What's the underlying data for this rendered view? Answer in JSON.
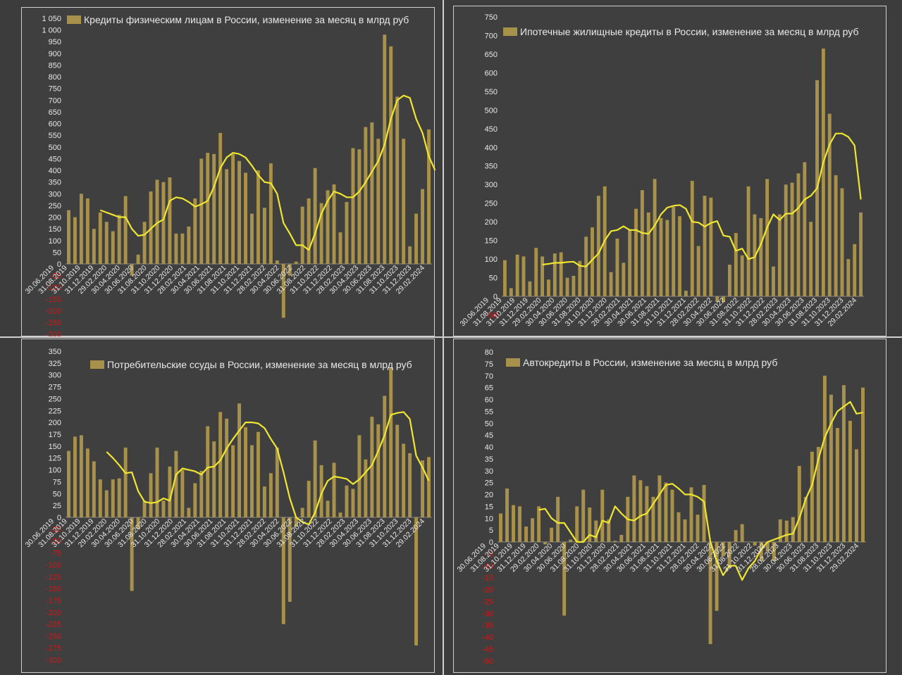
{
  "colors": {
    "bar": "#a8914a",
    "ma": "#f0e630",
    "text": "#e8e8e8",
    "neg_text": "#e01010",
    "background": "#404040"
  },
  "chart_data": [
    {
      "type": "bar",
      "legend": "Кредиты физическим лицам  в России, изменение за месяц в млрд руб",
      "ylim": [
        -300,
        1050
      ],
      "ystep": 50,
      "ytick_labels": [
        "-300",
        "-250",
        "-200",
        "-150",
        "-100",
        "-50",
        "0",
        "50",
        "100",
        "150",
        "200",
        "250",
        "300",
        "350",
        "400",
        "450",
        "500",
        "550",
        "600",
        "650",
        "700",
        "750",
        "800",
        "850",
        "900",
        "950",
        "1 000",
        "1 050"
      ],
      "xtick_labels": [
        "30.06.2019",
        "31.08.2019",
        "31.10.2019",
        "31.12.2019",
        "29.02.2020",
        "30.04.2020",
        "30.06.2020",
        "31.08.2020",
        "31.10.2020",
        "31.12.2020",
        "28.02.2021",
        "30.04.2021",
        "30.06.2021",
        "31.08.2021",
        "31.10.2021",
        "31.12.2021",
        "28.02.2022",
        "30.04.2022",
        "30.06.2022",
        "31.08.2022",
        "31.10.2022",
        "31.12.2022",
        "28.02.2023",
        "30.04.2023",
        "30.06.2023",
        "31.08.2023",
        "31.10.2023",
        "31.12.2023",
        "29.02.2024"
      ],
      "values": [
        230,
        200,
        300,
        280,
        150,
        220,
        180,
        140,
        210,
        290,
        -50,
        40,
        180,
        310,
        360,
        350,
        370,
        130,
        130,
        160,
        280,
        450,
        475,
        470,
        560,
        405,
        470,
        440,
        390,
        215,
        400,
        240,
        430,
        15,
        -230,
        -50,
        10,
        245,
        280,
        410,
        260,
        315,
        340,
        135,
        265,
        495,
        490,
        585,
        605,
        535,
        980,
        930,
        715,
        535,
        75,
        215,
        320,
        575
      ],
      "ma": [
        null,
        null,
        null,
        null,
        null,
        230,
        220,
        210,
        200,
        200,
        150,
        120,
        125,
        150,
        175,
        190,
        270,
        285,
        280,
        265,
        245,
        255,
        270,
        330,
        410,
        455,
        475,
        470,
        455,
        420,
        380,
        350,
        345,
        300,
        175,
        130,
        80,
        80,
        60,
        130,
        215,
        270,
        310,
        300,
        285,
        285,
        310,
        350,
        395,
        440,
        510,
        620,
        700,
        720,
        710,
        620,
        560,
        460,
        400
      ]
    },
    {
      "type": "bar",
      "legend": "Ипотечные жилищные кредиты в России, изменение за месяц в млрд руб",
      "ylim": [
        -50,
        750
      ],
      "ystep": 50,
      "ytick_labels": [
        "-50",
        "0",
        "50",
        "100",
        "150",
        "200",
        "250",
        "300",
        "350",
        "400",
        "450",
        "500",
        "550",
        "600",
        "650",
        "700",
        "750"
      ],
      "xtick_labels": [
        "30.06.2019",
        "31.08.2019",
        "31.10.2019",
        "31.12.2019",
        "29.02.2020",
        "30.04.2020",
        "30.06.2020",
        "31.08.2020",
        "31.10.2020",
        "31.12.2020",
        "28.02.2021",
        "30.04.2021",
        "30.06.2021",
        "31.08.2021",
        "31.10.2021",
        "31.12.2021",
        "28.02.2022",
        "30.04.2022",
        "30.06.2022",
        "31.08.2022",
        "31.10.2022",
        "31.12.2022",
        "28.02.2023",
        "30.04.2023",
        "30.06.2023",
        "31.08.2023",
        "31.10.2023",
        "31.12.2023",
        "29.02.2024"
      ],
      "values": [
        97,
        22,
        112,
        107,
        40,
        130,
        107,
        45,
        115,
        118,
        50,
        55,
        95,
        160,
        185,
        270,
        295,
        65,
        155,
        90,
        180,
        235,
        285,
        225,
        315,
        210,
        205,
        240,
        215,
        15,
        310,
        135,
        270,
        265,
        -15,
        -15,
        85,
        170,
        110,
        295,
        220,
        210,
        315,
        80,
        220,
        300,
        305,
        330,
        360,
        200,
        580,
        665,
        490,
        325,
        290,
        100,
        140,
        225
      ],
      "ma": [
        null,
        null,
        null,
        null,
        null,
        null,
        85,
        87,
        90,
        90,
        92,
        93,
        82,
        80,
        98,
        115,
        150,
        175,
        178,
        188,
        178,
        178,
        170,
        168,
        190,
        220,
        238,
        243,
        245,
        235,
        200,
        198,
        187,
        197,
        202,
        163,
        160,
        122,
        128,
        100,
        105,
        140,
        185,
        220,
        205,
        222,
        222,
        237,
        260,
        270,
        290,
        360,
        408,
        437,
        437,
        428,
        405,
        260
      ]
    },
    {
      "type": "bar",
      "legend": "Потребительские ссуды в России, изменение за месяц в млрд руб",
      "ylim": [
        -300,
        350
      ],
      "ystep": 25,
      "ytick_labels": [
        "-300",
        "-275",
        "-250",
        "-225",
        "-200",
        "-175",
        "-150",
        "-125",
        "-100",
        "-75",
        "-50",
        "-25",
        "0",
        "25",
        "50",
        "75",
        "100",
        "125",
        "150",
        "175",
        "200",
        "225",
        "250",
        "275",
        "300",
        "325",
        "350"
      ],
      "xtick_labels": [
        "30.06.2019",
        "31.08.2019",
        "31.10.2019",
        "31.12.2019",
        "29.02.2020",
        "30.04.2020",
        "30.06.2020",
        "31.08.2020",
        "31.10.2020",
        "31.12.2020",
        "28.02.2021",
        "30.04.2021",
        "30.06.2021",
        "31.08.2021",
        "31.10.2021",
        "31.12.2021",
        "28.02.2022",
        "30.04.2022",
        "30.06.2022",
        "31.08.2022",
        "31.10.2022",
        "31.12.2022",
        "28.02.2023",
        "30.04.2023",
        "30.06.2023",
        "31.08.2023",
        "31.10.2023",
        "31.12.2023",
        "29.02.2024"
      ],
      "values": [
        140,
        170,
        173,
        145,
        118,
        80,
        57,
        80,
        82,
        147,
        -155,
        -25,
        35,
        93,
        147,
        35,
        107,
        140,
        100,
        20,
        72,
        98,
        192,
        160,
        222,
        208,
        152,
        240,
        190,
        152,
        180,
        65,
        93,
        147,
        -225,
        -178,
        -20,
        20,
        77,
        162,
        110,
        35,
        115,
        10,
        67,
        60,
        173,
        122,
        212,
        196,
        256,
        316,
        195,
        155,
        135,
        -270,
        120,
        127
      ],
      "ma": [
        null,
        null,
        null,
        null,
        null,
        null,
        138,
        125,
        110,
        93,
        95,
        55,
        33,
        30,
        32,
        40,
        35,
        90,
        103,
        100,
        97,
        90,
        105,
        107,
        120,
        145,
        165,
        183,
        200,
        200,
        198,
        188,
        165,
        145,
        95,
        40,
        0,
        -10,
        -15,
        10,
        50,
        77,
        86,
        84,
        81,
        70,
        80,
        95,
        110,
        140,
        173,
        216,
        220,
        222,
        207,
        130,
        105,
        77
      ]
    },
    {
      "type": "bar",
      "legend": "Автокредиты в России, изменение за месяц в млрд руб",
      "ylim": [
        -50,
        80
      ],
      "ystep": 5,
      "ytick_labels": [
        "-50",
        "-45",
        "-40",
        "-35",
        "-30",
        "-25",
        "-20",
        "-15",
        "-10",
        "-5",
        "0",
        "5",
        "10",
        "15",
        "20",
        "25",
        "30",
        "35",
        "40",
        "45",
        "50",
        "55",
        "60",
        "65",
        "70",
        "75",
        "80"
      ],
      "xtick_labels": [
        "30.06.2019",
        "31.08.2019",
        "31.10.2019",
        "31.12.2019",
        "29.02.2020",
        "30.04.2020",
        "30.06.2020",
        "31.08.2020",
        "31.10.2020",
        "31.12.2020",
        "28.02.2021",
        "30.04.2021",
        "30.06.2021",
        "31.08.2021",
        "31.10.2021",
        "31.12.2021",
        "28.02.2022",
        "30.04.2022",
        "30.06.2022",
        "31.08.2022",
        "31.10.2022",
        "31.12.2022",
        "28.02.2023",
        "30.04.2023",
        "30.06.2023",
        "31.08.2023",
        "31.10.2023",
        "31.12.2023",
        "29.02.2024"
      ],
      "values": [
        12,
        22.5,
        15.5,
        15,
        6.5,
        10,
        15,
        -1,
        6,
        19,
        -31,
        1,
        15,
        22,
        14.5,
        9,
        22,
        9.5,
        0.5,
        3,
        19,
        28,
        26,
        23.5,
        19,
        28,
        25,
        22,
        12.5,
        9.5,
        23,
        11.5,
        24,
        -43,
        -29,
        -6,
        -11,
        5,
        7.5,
        0,
        -1.5,
        -8,
        -4,
        -8,
        9.5,
        9,
        10.5,
        32,
        19,
        38,
        40,
        70,
        62,
        48,
        66,
        51,
        39,
        65
      ],
      "ma": [
        null,
        null,
        null,
        null,
        null,
        null,
        13.5,
        14,
        10,
        8,
        8,
        4,
        0,
        0,
        3,
        2,
        9,
        8,
        15,
        12,
        9.5,
        9,
        11,
        12,
        16,
        20,
        24,
        24.5,
        22.5,
        20,
        20,
        19,
        17,
        0,
        -8,
        -14,
        -10,
        -10,
        -16,
        -11,
        -8,
        -3,
        0,
        1,
        2,
        3,
        3.5,
        10,
        18,
        24,
        35,
        44,
        50,
        55,
        57,
        59,
        54,
        54.5
      ]
    }
  ]
}
